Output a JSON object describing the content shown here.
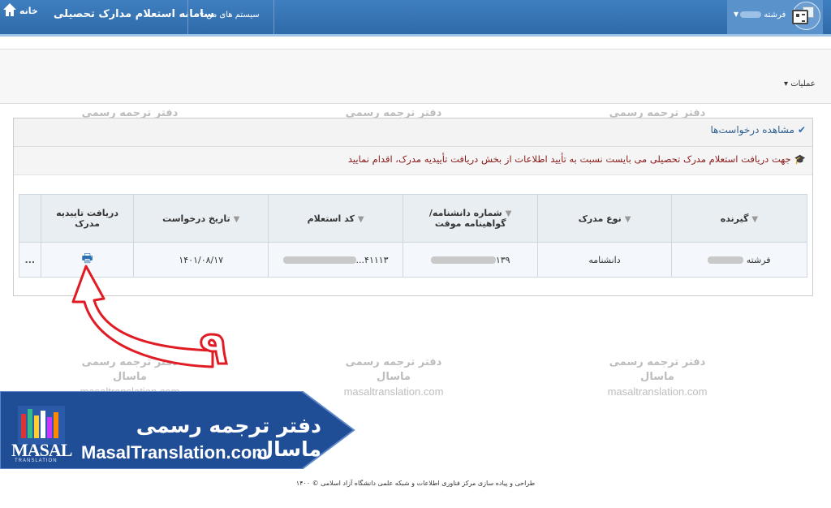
{
  "topbar": {
    "home_label": "خانه",
    "app_title": "سامانه استعلام مدارک تحصیلی",
    "my_systems": "سیستم های من",
    "user_name": "فرشته"
  },
  "operations": {
    "label": "عملیات"
  },
  "panel": {
    "title": "مشاهده درخواست‌ها",
    "notice": "جهت دریافت استعلام مدرک تحصیلی می بایست نسبت به تأیید اطلاعات از بخش دریافت تأییدیه مدرک، اقدام نمایید"
  },
  "table": {
    "headers": {
      "recipient": "گیرنده",
      "doc_type": "نوع مدرک",
      "cert_number": "شماره دانشنامه/گواهینامه موقت",
      "inquiry_code": "کد استعلام",
      "request_date": "تاریخ درخواست",
      "get_confirmation": "دریافت تاییدیه مدرک"
    },
    "row": {
      "recipient": "فرشته",
      "doc_type": "دانشنامه",
      "cert_number": "۱۳۹",
      "inquiry_code": "۴۱۱۱۳...",
      "request_date": "۱۴۰۱/۰۸/۱۷",
      "more": "..."
    }
  },
  "watermark": {
    "fa": "دفتر ترجمه رسمی ماسال",
    "en": "masaltranslation.com"
  },
  "annotation": {
    "step_number": "۹"
  },
  "banner": {
    "fa": "دفتر ترجمه رسمی ماسال",
    "en": "MasalTranslation.com",
    "logo": "MASAL",
    "logo_sub": "TRANSLATION"
  },
  "footer": "طراحی و پیاده سازی مرکز فناوری اطلاعات و شبکه علمی دانشگاه آزاد اسلامی © ۱۴۰۰",
  "colors": {
    "topbar": "#3a78b8",
    "banner": "#1f4d96",
    "notice": "#8b1a1a",
    "arrow": "#e01b24"
  }
}
